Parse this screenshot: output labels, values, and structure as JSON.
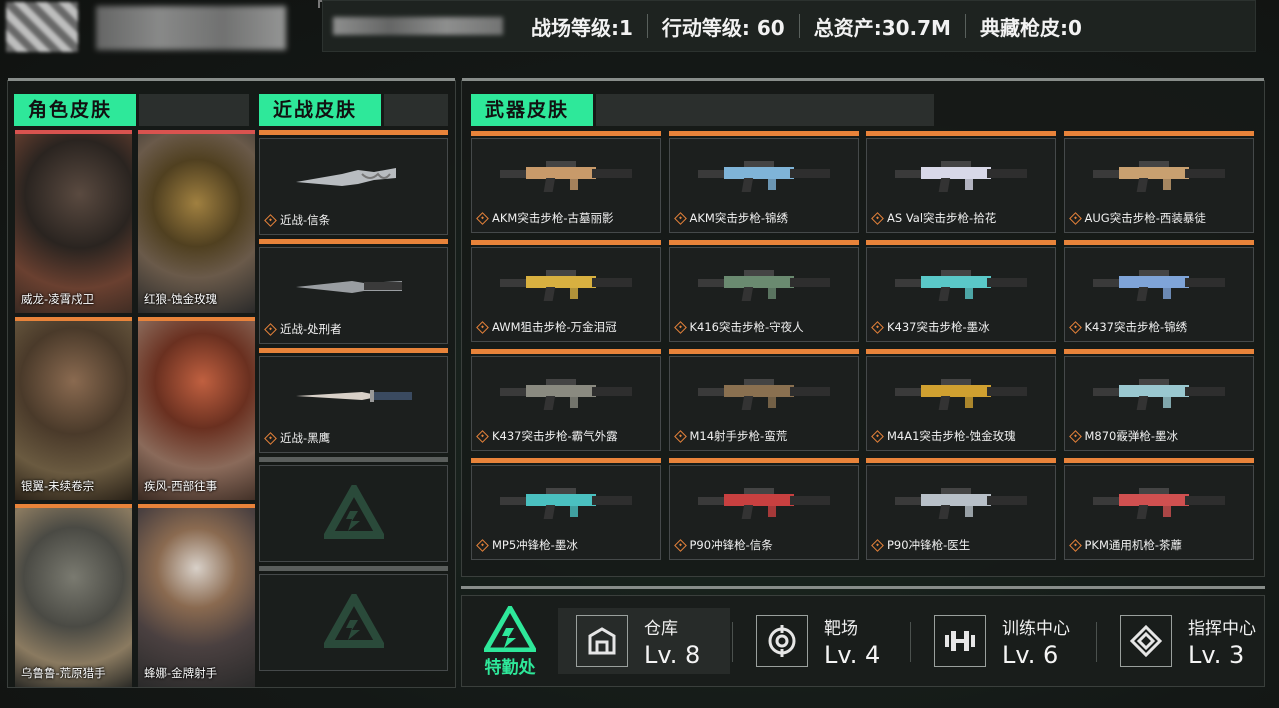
{
  "header": {
    "stats": [
      {
        "label": "战场等级:1"
      },
      {
        "label": "行动等级: 60"
      },
      {
        "label": "总资产:30.7M"
      },
      {
        "label": "典藏枪皮:0"
      }
    ]
  },
  "sections": {
    "character": "角色皮肤",
    "melee": "近战皮肤",
    "weapon": "武器皮肤"
  },
  "characters": [
    {
      "label": "威龙-凌霄戍卫",
      "bar_color": "#d9534f"
    },
    {
      "label": "红狼-蚀金玫瑰",
      "bar_color": "#d9534f"
    },
    {
      "label": "银翼-未续卷宗",
      "bar_color": "#e8833a"
    },
    {
      "label": "疾风-西部往事",
      "bar_color": "#e8833a"
    },
    {
      "label": "乌鲁鲁-荒原猎手",
      "bar_color": "#e8833a"
    },
    {
      "label": "蜂娜-金牌射手",
      "bar_color": "#e8833a"
    }
  ],
  "melee": [
    {
      "label": "近战-信条"
    },
    {
      "label": "近战-处刑者"
    },
    {
      "label": "近战-黑鹰"
    }
  ],
  "weapons": [
    {
      "label": "AKM突击步枪-古墓丽影",
      "accent": "#c89a6a"
    },
    {
      "label": "AKM突击步枪-锦绣",
      "accent": "#7fb4d8"
    },
    {
      "label": "AS Val突击步枪-拾花",
      "accent": "#d8d8e8"
    },
    {
      "label": "AUG突击步枪-西装暴徒",
      "accent": "#c8a070"
    },
    {
      "label": "AWM狙击步枪-万金泪冠",
      "accent": "#d8b040"
    },
    {
      "label": "K416突击步枪-守夜人",
      "accent": "#6a8a70"
    },
    {
      "label": "K437突击步枪-墨冰",
      "accent": "#5ac8c8"
    },
    {
      "label": "K437突击步枪-锦绣",
      "accent": "#7fa4d8"
    },
    {
      "label": "K437突击步枪-霸气外露",
      "accent": "#8a8a80"
    },
    {
      "label": "M14射手步枪-蛮荒",
      "accent": "#8a7050"
    },
    {
      "label": "M4A1突击步枪-蚀金玫瑰",
      "accent": "#d0a030"
    },
    {
      "label": "M870霰弹枪-墨冰",
      "accent": "#9ac8d0"
    },
    {
      "label": "MP5冲锋枪-墨冰",
      "accent": "#4ac0c0"
    },
    {
      "label": "P90冲锋枪-信条",
      "accent": "#c84040"
    },
    {
      "label": "P90冲锋枪-医生",
      "accent": "#b8c0c8"
    },
    {
      "label": "PKM通用机枪-茶蘼",
      "accent": "#d05050"
    }
  ],
  "headquarters": {
    "label": "特勤处"
  },
  "facilities": [
    {
      "name": "仓库",
      "level": "Lv. 8",
      "icon": "warehouse-icon"
    },
    {
      "name": "靶场",
      "level": "Lv. 4",
      "icon": "target-icon"
    },
    {
      "name": "训练中心",
      "level": "Lv. 6",
      "icon": "dumbbell-icon"
    },
    {
      "name": "指挥中心",
      "level": "Lv. 3",
      "icon": "command-icon"
    }
  ],
  "colors": {
    "accent": "#2ee89a",
    "rarity_orange": "#e8833a",
    "rarity_red": "#d9534f"
  }
}
